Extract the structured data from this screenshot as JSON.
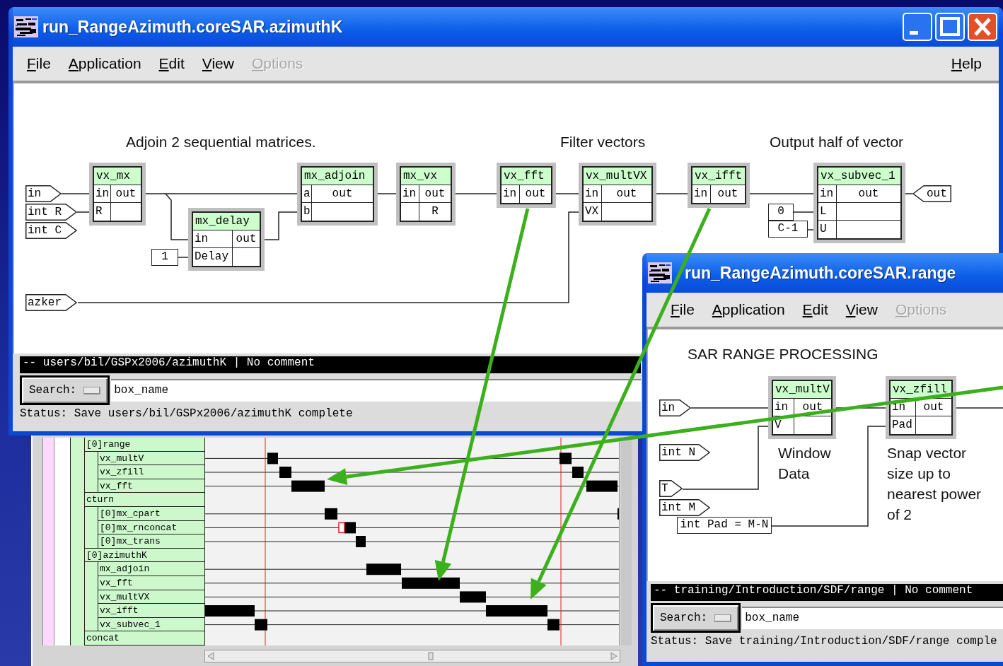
{
  "windows": [
    {
      "title": "run_RangeAzimuth.coreSAR.azimuthK",
      "menu": [
        {
          "label": "File",
          "disabled": false
        },
        {
          "label": "Application",
          "disabled": false
        },
        {
          "label": "Edit",
          "disabled": false
        },
        {
          "label": "View",
          "disabled": false
        },
        {
          "label": "Options",
          "disabled": true
        }
      ],
      "help": "Help",
      "comments": [
        "Adjoin 2 sequential matrices.",
        "Filter vectors",
        "Output half of vector"
      ],
      "nodes": [
        {
          "name": "vx_mx",
          "rows": [
            {
              "left": "in",
              "right": "out"
            },
            {
              "left": "R"
            }
          ]
        },
        {
          "name": "mx_delay",
          "rows": [
            {
              "left": "in",
              "right": "out"
            },
            {
              "left": "Delay"
            }
          ]
        },
        {
          "name": "mx_adjoin",
          "rows": [
            {
              "left": "a",
              "right": "out"
            },
            {
              "left": "b"
            }
          ]
        },
        {
          "name": "mx_vx",
          "rows": [
            {
              "left": "in",
              "right": "out"
            },
            {
              "right": "R"
            }
          ]
        },
        {
          "name": "vx_fft",
          "rows": [
            {
              "left": "in",
              "right": "out"
            }
          ]
        },
        {
          "name": "vx_multVX",
          "rows": [
            {
              "left": "in",
              "right": "out"
            },
            {
              "left": "VX"
            }
          ]
        },
        {
          "name": "vx_ifft",
          "rows": [
            {
              "left": "in",
              "right": "out"
            }
          ]
        },
        {
          "name": "vx_subvec_1",
          "rows": [
            {
              "left": "in",
              "right": "out"
            },
            {
              "left": "L"
            },
            {
              "left": "U"
            }
          ]
        }
      ],
      "ports": [
        {
          "label": "in",
          "kind": "input"
        },
        {
          "label": "int R",
          "kind": "input"
        },
        {
          "label": "int C",
          "kind": "input"
        },
        {
          "label": "azker",
          "kind": "input"
        },
        {
          "label": "out",
          "kind": "output"
        }
      ],
      "constants": [
        "1",
        "0",
        "C-1"
      ],
      "comment_bar": "-- users/bil/GSPx2006/azimuthK | No comment",
      "search": {
        "label": "Search:",
        "value": "box_name"
      },
      "status": "Status: Save users/bil/GSPx2006/azimuthK complete"
    },
    {
      "title": "run_RangeAzimuth.coreSAR.range",
      "menu": [
        {
          "label": "File",
          "disabled": false
        },
        {
          "label": "Application",
          "disabled": false
        },
        {
          "label": "Edit",
          "disabled": false
        },
        {
          "label": "View",
          "disabled": false
        },
        {
          "label": "Options",
          "disabled": true
        }
      ],
      "comments": [
        "SAR RANGE PROCESSING",
        "Window Data",
        "Snap vector size up to nearest power of 2"
      ],
      "nodes": [
        {
          "name": "vx_multV",
          "rows": [
            {
              "left": "in",
              "right": "out"
            },
            {
              "left": "V"
            }
          ]
        },
        {
          "name": "vx_zfill",
          "rows": [
            {
              "left": "in",
              "right": "out"
            },
            {
              "left": "Pad"
            }
          ]
        }
      ],
      "ports": [
        {
          "label": "in",
          "kind": "input"
        },
        {
          "label": "int N",
          "kind": "input"
        },
        {
          "label": "T",
          "kind": "input"
        },
        {
          "label": "int M",
          "kind": "input"
        }
      ],
      "constants": [
        "int Pad = M-N"
      ],
      "comment_bar": "-- training/Introduction/SDF/range | No comment",
      "search": {
        "label": "Search:",
        "value": "box_name"
      },
      "status": "Status: Save training/Introduction/SDF/range comple"
    }
  ],
  "trace": {
    "rows": [
      {
        "label": "[0]range",
        "children": [
          {
            "label": "vx_multV"
          },
          {
            "label": "vx_zfill"
          },
          {
            "label": "vx_fft"
          }
        ]
      },
      {
        "label": "cturn",
        "children": [
          {
            "label": "[0]mx_cpart"
          },
          {
            "label": "[0]mx_rnconcat"
          },
          {
            "label": "[0]mx_trans"
          }
        ]
      },
      {
        "label": "[0]azimuthK",
        "children": [
          {
            "label": "mx_adjoin"
          },
          {
            "label": "vx_fft"
          },
          {
            "label": "vx_multVX"
          },
          {
            "label": "vx_ifft"
          },
          {
            "label": "vx_subvec_1"
          }
        ]
      },
      {
        "label": "concat"
      }
    ]
  }
}
